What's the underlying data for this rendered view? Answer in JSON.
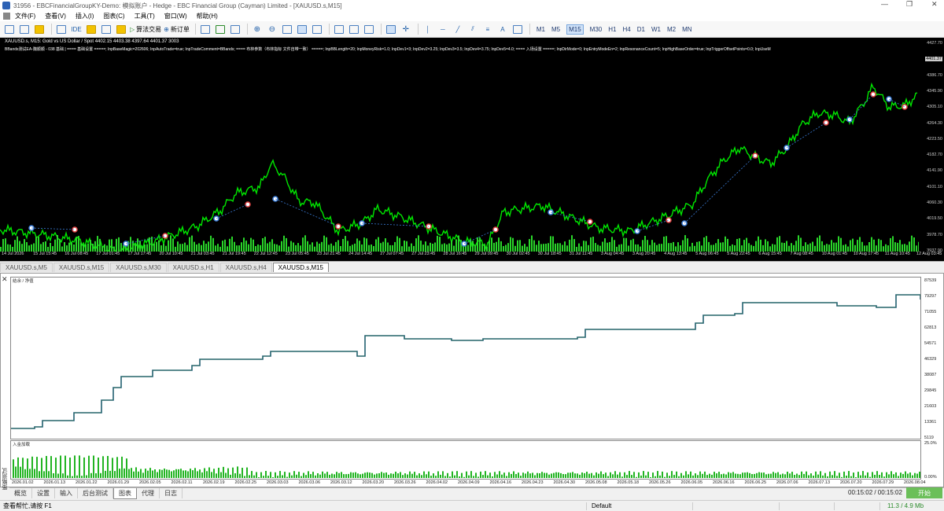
{
  "window": {
    "title": "31956 - EBCFinancialGroupKY-Demo: 模拟账户 - Hedge - EBC Financial Group (Cayman) Limited - [XAUUSD.s,M15]"
  },
  "menu": [
    "文件(F)",
    "查看(V)",
    "插入(I)",
    "图表(C)",
    "工具(T)",
    "窗口(W)",
    "帮助(H)"
  ],
  "toolbar": {
    "ide": "IDE",
    "algo": "算法交易",
    "new_order": "新订单",
    "timeframes": [
      "M1",
      "M5",
      "M15",
      "M30",
      "H1",
      "H4",
      "D1",
      "W1",
      "M2",
      "MN"
    ],
    "active_tf": "M15"
  },
  "chart": {
    "header": "XAUUSD.s, M15:  Gold vs US Dollar / Spot   4402.15 4403.38 4397.64 4401.37   3003",
    "ea_line": "BBands测试EA-魏顺顺 - 038 基础 | ==== 基础设置 =====; InpBaseMagic=202606; InpAutoTrade=true; InpTradeComment=BBands; ==== 布林参数（布林指标 文件自带一致） =====; InpBBLength=20; InpMoneyRisk=1.0; InpDev1=3; InpDev2=3.25; InpDev3=3.5; InpDev4=3.75; InpDev5=4.0; ==== 入场设置 =====; InpDirMode=0; InpEntryModeEn=2; InpResonanceCount=5; InpHighBaseOrder=true; InpTriggerOffsetPoints=0.0; InpUseM",
    "price_labels": [
      "4427.70",
      "4401.37",
      "4386.70",
      "4345.90",
      "4305.10",
      "4264.30",
      "4223.50",
      "4182.70",
      "4141.90",
      "4101.10",
      "4060.30",
      "4019.50",
      "3978.70",
      "3937.90"
    ],
    "current_price": "4401.37",
    "time_labels": [
      "14 Jul 2026",
      "15 Jul 15:45",
      "16 Jul 08:45",
      "17 Jul 01:45",
      "17 Jul 17:45",
      "20 Jul 10:45",
      "21 Jul 03:45",
      "21 Jul 19:45",
      "22 Jul 12:45",
      "23 Jul 05:45",
      "23 Jul 21:45",
      "24 Jul 14:45",
      "27 Jul 07:45",
      "27 Jul 23:45",
      "28 Jul 16:45",
      "29 Jul 09:45",
      "30 Jul 02:45",
      "30 Jul 18:45",
      "31 Jul 11:45",
      "3 Aug 04:45",
      "3 Aug 20:45",
      "4 Aug 13:45",
      "5 Aug 06:45",
      "5 Aug 22:45",
      "6 Aug 15:45",
      "7 Aug 08:45",
      "10 Aug 01:45",
      "10 Aug 17:45",
      "11 Aug 10:45",
      "12 Aug 03:45"
    ],
    "colors": {
      "candle": "#00e600",
      "volume": "#2ad62a",
      "bg": "#000000",
      "buy_trade": "#3a7bd5",
      "sell_trade": "#e04040"
    }
  },
  "chart_tabs": [
    "XAUUSD.s,M5",
    "XAUUSD.s,M15",
    "XAUUSD.s,M30",
    "XAUUSD.s,H1",
    "XAUUSD.s,H4",
    "XAUUSD.s,M15"
  ],
  "active_chart_tab": 5,
  "tester": {
    "side_label": "策略测试",
    "balance_title": "结余 / 净值",
    "balance_axis": [
      "87539",
      "79297",
      "71055",
      "62813",
      "54571",
      "46329",
      "38087",
      "29845",
      "21603",
      "13361",
      "5119"
    ],
    "deposit_title": "入金加载",
    "deposit_axis": [
      "25.0%",
      "0.00%"
    ],
    "dates": [
      "2026.01.02",
      "2026.01.13",
      "2026.01.22",
      "2026.01.29",
      "2026.02.05",
      "2026.02.11",
      "2026.02.19",
      "2026.02.25",
      "2026.03.03",
      "2026.03.06",
      "2026.03.12",
      "2026.03.20",
      "2026.03.26",
      "2026.04.02",
      "2026.04.09",
      "2026.04.16",
      "2026.04.23",
      "2026.04.30",
      "2026.05.08",
      "2026.05.18",
      "2026.05.26",
      "2026.06.05",
      "2026.06.16",
      "2026.06.25",
      "2026.07.06",
      "2026.07.13",
      "2026.07.20",
      "2026.07.29",
      "2026.08.04"
    ],
    "tabs": [
      "概览",
      "设置",
      "输入",
      "后台测试",
      "图表",
      "代理",
      "日志"
    ],
    "active_tab": "图表",
    "timer": "00:15:02 / 00:15:02",
    "start": "开始"
  },
  "status": {
    "help": "查看帮忙,请按 F1",
    "profile": "Default",
    "net": "11.3 / 4.9 Mb"
  }
}
